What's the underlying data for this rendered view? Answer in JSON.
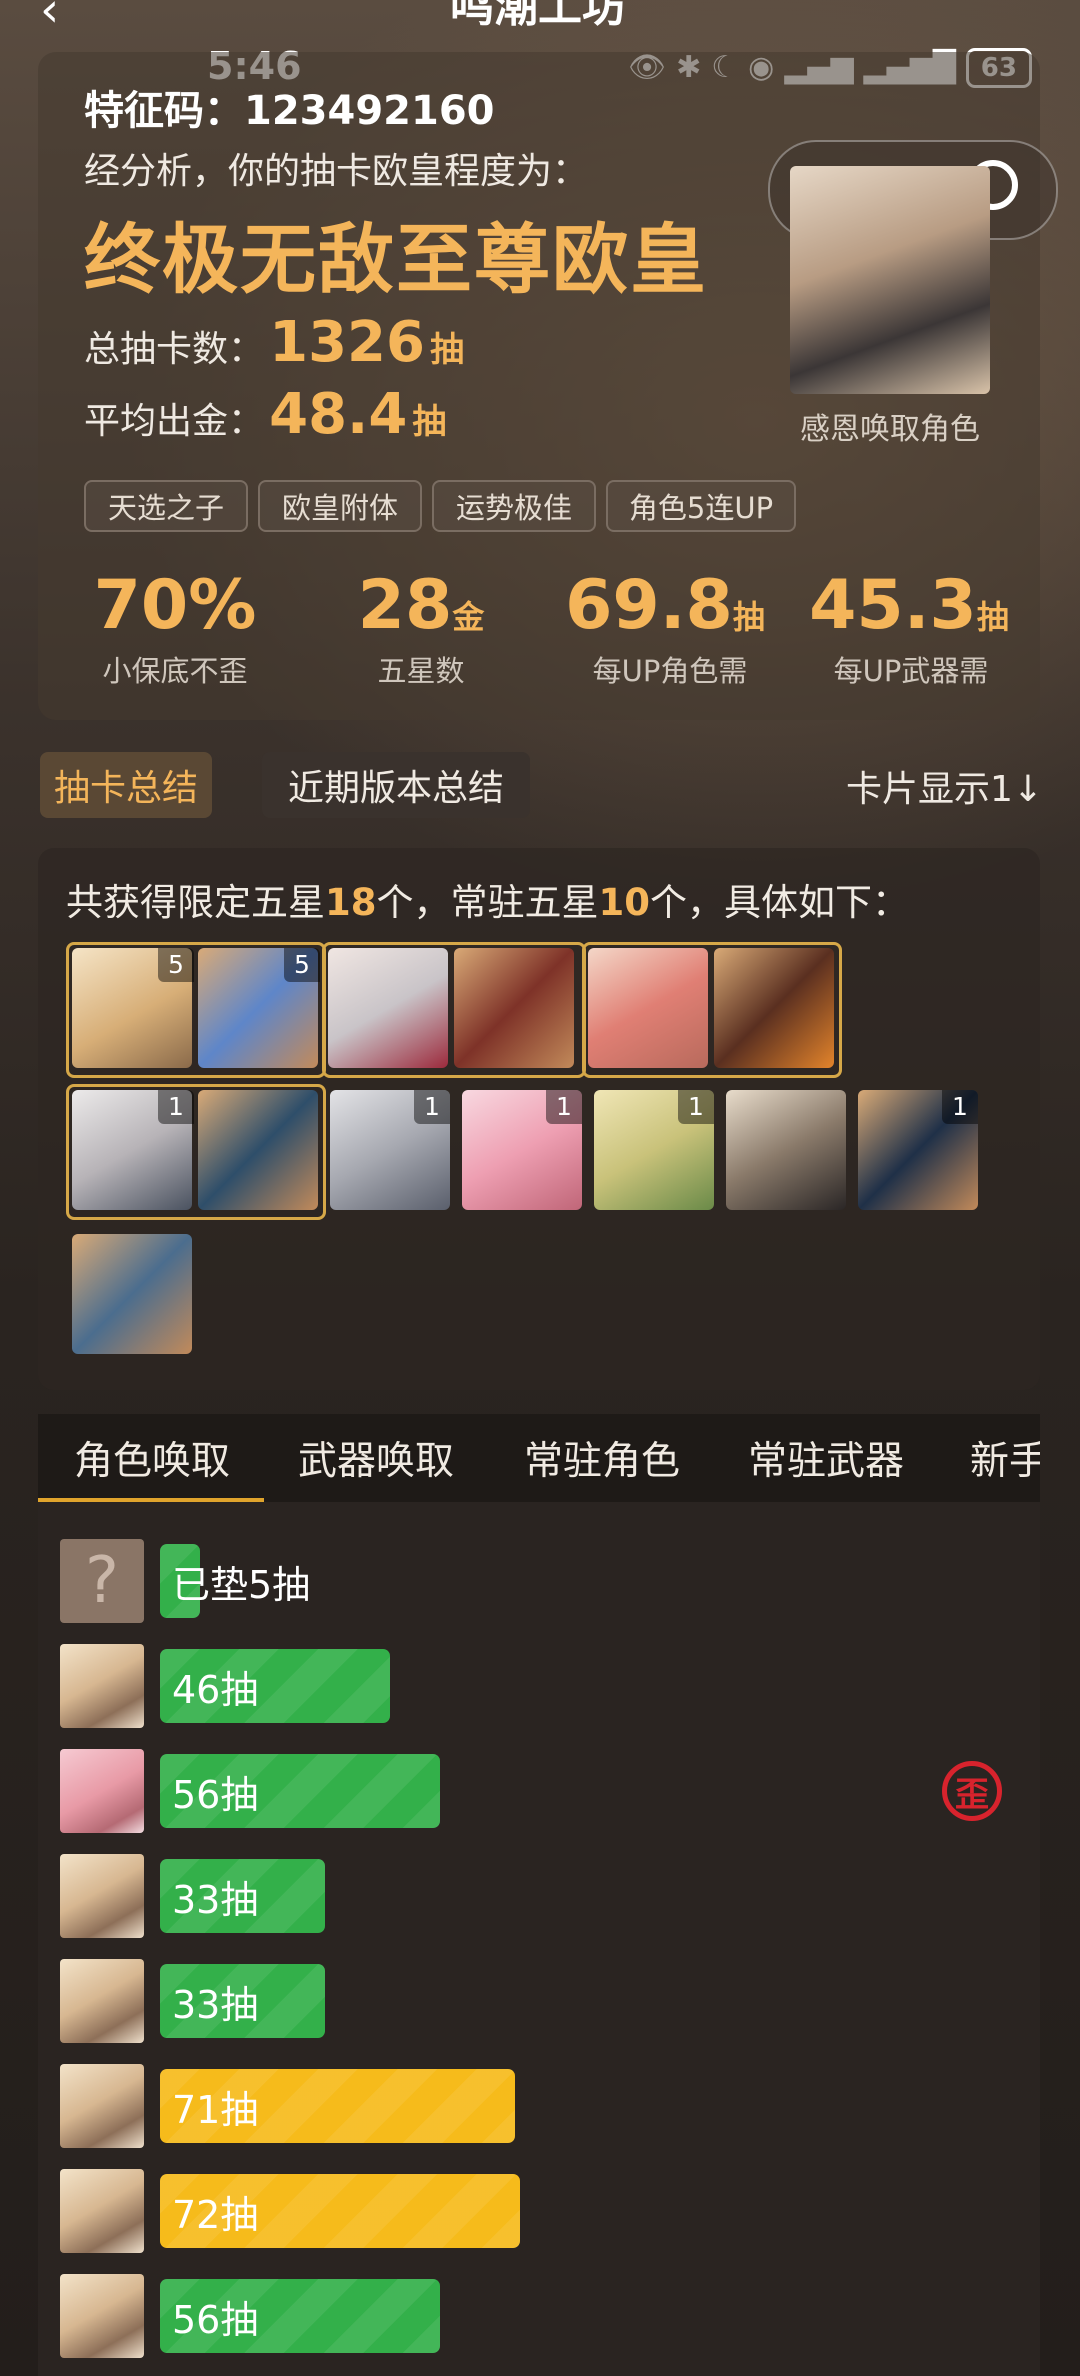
{
  "status_bar": {
    "time": "5:46",
    "battery": "63"
  },
  "nav": {
    "title": "鸣潮工坊"
  },
  "summary": {
    "code_label": "特征码：",
    "code": "123492160",
    "analysis_text": "经分析，你的抽卡欧皇程度为：",
    "rank": "终极无敌至尊欧皇",
    "total_label": "总抽卡数：",
    "total_value": "1326",
    "avg_label": "平均出金：",
    "avg_value": "48.4",
    "pull_unit": "抽",
    "tags": [
      "天选之子",
      "欧皇附体",
      "运势极佳",
      "角色5连UP"
    ],
    "metrics": [
      {
        "value": "70%",
        "unit": "",
        "label": "小保底不歪"
      },
      {
        "value": "28",
        "unit": "金",
        "label": "五星数"
      },
      {
        "value": "69.8",
        "unit": "抽",
        "label": "每UP角色需"
      },
      {
        "value": "45.3",
        "unit": "抽",
        "label": "每UP武器需"
      }
    ],
    "portrait_caption": "感恩唤取角色"
  },
  "summary_tabs": {
    "active": "抽卡总结",
    "other": "近期版本总结",
    "card_display": "卡片显示1↓"
  },
  "items": {
    "head_prefix": "共获得限定五星",
    "limited": "18",
    "head_mid": "个，常驻五星",
    "standard": "10",
    "head_suffix": "个，具体如下：",
    "row1_counts": [
      "5",
      "5"
    ],
    "row2_counts": [
      "1",
      "1",
      "1",
      "1",
      "1"
    ]
  },
  "history_tabs": [
    "角色唤取",
    "武器唤取",
    "常驻角色",
    "常驻武器",
    "新手"
  ],
  "records": [
    {
      "label": "已垫5抽",
      "pulls": 5,
      "color": "green",
      "avatar": "unknown",
      "avatar_text": "?"
    },
    {
      "label": "46抽",
      "pulls": 46,
      "color": "green",
      "avatar": "blonde"
    },
    {
      "label": "56抽",
      "pulls": 56,
      "color": "green",
      "avatar": "pink",
      "mark": "歪"
    },
    {
      "label": "33抽",
      "pulls": 33,
      "color": "green",
      "avatar": "blonde"
    },
    {
      "label": "33抽",
      "pulls": 33,
      "color": "green",
      "avatar": "blonde"
    },
    {
      "label": "71抽",
      "pulls": 71,
      "color": "gold",
      "avatar": "blonde"
    },
    {
      "label": "72抽",
      "pulls": 72,
      "color": "gold",
      "avatar": "blonde"
    },
    {
      "label": "56抽",
      "pulls": 56,
      "color": "green",
      "avatar": "blonde"
    }
  ],
  "colors": {
    "accent": "#f4b55a",
    "green": "#33b04a",
    "gold": "#f6bb1b",
    "wai": "#d8232d"
  }
}
